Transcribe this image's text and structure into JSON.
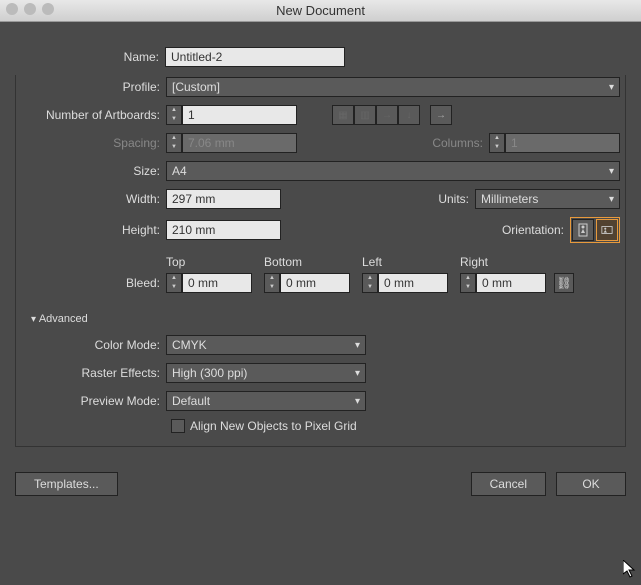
{
  "title": "New Document",
  "name": {
    "label": "Name:",
    "value": "Untitled-2"
  },
  "profile": {
    "label": "Profile:",
    "value": "[Custom]"
  },
  "artboards": {
    "label": "Number of Artboards:",
    "value": "1"
  },
  "spacing": {
    "label": "Spacing:",
    "value": "7.06 mm"
  },
  "columns": {
    "label": "Columns:",
    "value": "1"
  },
  "size": {
    "label": "Size:",
    "value": "A4"
  },
  "width": {
    "label": "Width:",
    "value": "297 mm"
  },
  "height": {
    "label": "Height:",
    "value": "210 mm"
  },
  "units": {
    "label": "Units:",
    "value": "Millimeters"
  },
  "orientation": {
    "label": "Orientation:"
  },
  "bleed": {
    "label": "Bleed:",
    "top": {
      "label": "Top",
      "value": "0 mm"
    },
    "bottom": {
      "label": "Bottom",
      "value": "0 mm"
    },
    "left": {
      "label": "Left",
      "value": "0 mm"
    },
    "right": {
      "label": "Right",
      "value": "0 mm"
    }
  },
  "advanced": {
    "label": "Advanced",
    "colorMode": {
      "label": "Color Mode:",
      "value": "CMYK"
    },
    "rasterEffects": {
      "label": "Raster Effects:",
      "value": "High (300 ppi)"
    },
    "previewMode": {
      "label": "Preview Mode:",
      "value": "Default"
    },
    "alignPixel": "Align New Objects to Pixel Grid"
  },
  "buttons": {
    "templates": "Templates...",
    "cancel": "Cancel",
    "ok": "OK"
  }
}
